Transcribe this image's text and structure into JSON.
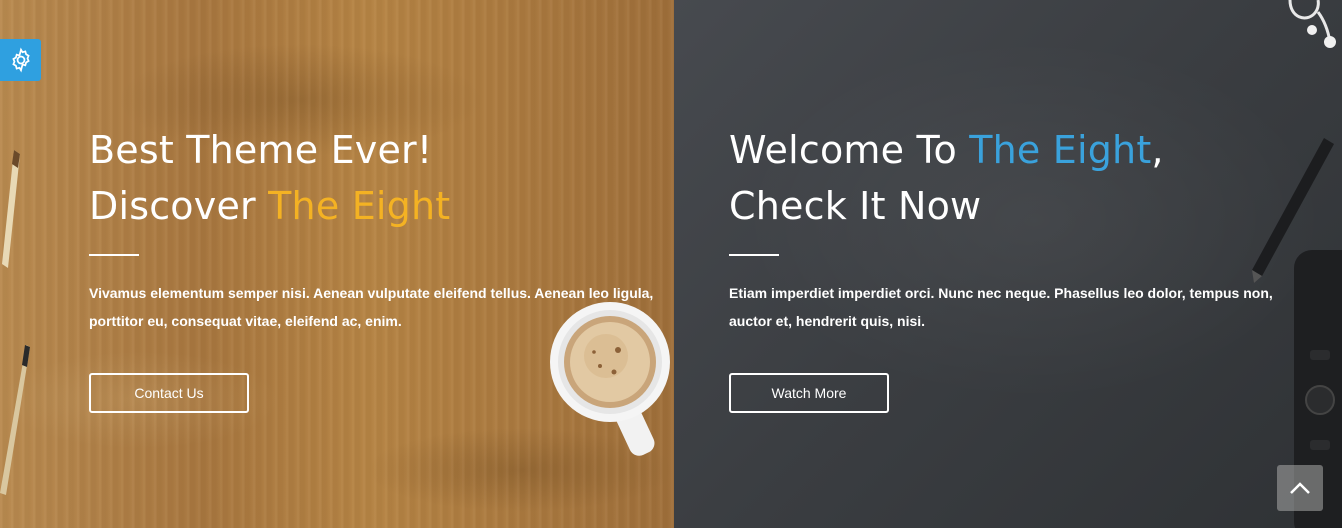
{
  "left_slide": {
    "heading_line1": "Best Theme Ever!",
    "heading_line2_prefix": "Discover ",
    "heading_line2_accent": "The Eight",
    "description": "Vivamus elementum semper nisi. Aenean vulputate eleifend tellus. Aenean leo ligula, porttitor eu, consequat vitae, eleifend ac, enim.",
    "button_label": "Contact Us"
  },
  "right_slide": {
    "heading_line1_prefix": "Welcome To ",
    "heading_line1_accent": "The Eight",
    "heading_line1_suffix": ",",
    "heading_line2": "Check It Now",
    "description": "Etiam imperdiet imperdiet orci. Nunc nec neque. Phasellus leo dolor, tempus non, auctor et, hendrerit quis, nisi.",
    "button_label": "Watch More"
  },
  "icons": {
    "settings": "gear-icon",
    "scroll_top": "chevron-up-icon"
  },
  "colors": {
    "accent_orange": "#f4b223",
    "accent_blue": "#3aa2dc",
    "settings_bg": "#2fa0e0"
  }
}
